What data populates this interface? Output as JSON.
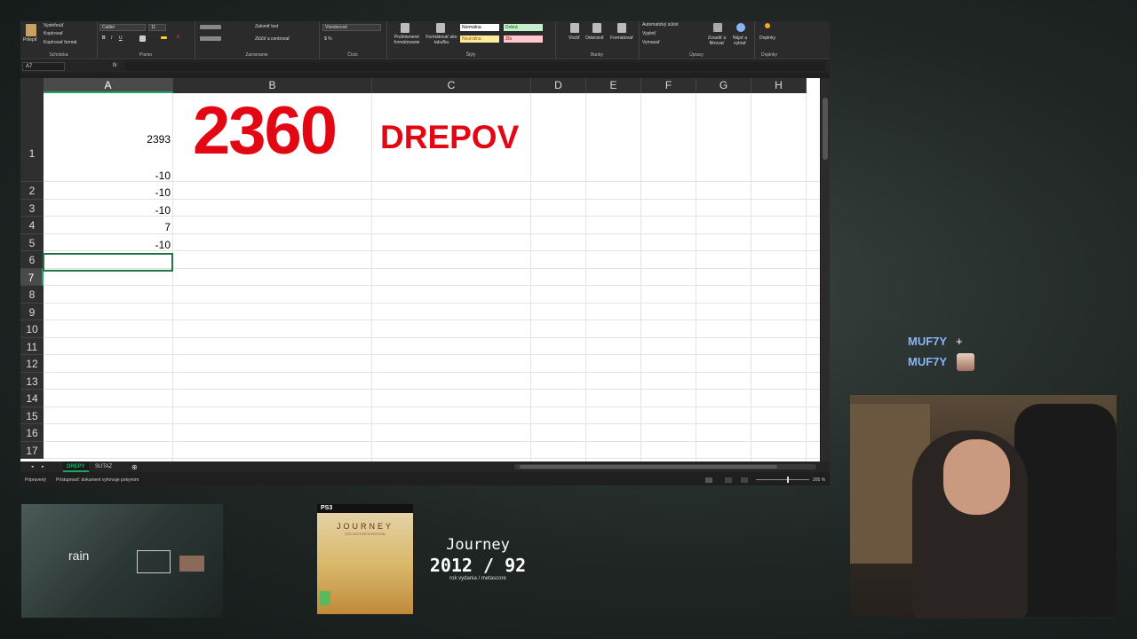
{
  "excel": {
    "ribbon": {
      "clipboard": {
        "paste": "Prilepiť",
        "cut": "Vystrihnúť",
        "copy": "Kopírovať",
        "format_painter": "Kopírovať formát",
        "label": "Schránka"
      },
      "font": {
        "name": "Calibri",
        "size": "11",
        "label": "Písmo"
      },
      "alignment": {
        "wrap": "Zalomiť text",
        "merge": "Zlúčiť a centrovať",
        "label": "Zarovnanie"
      },
      "number": {
        "format": "Všeobecné",
        "label": "Číslo"
      },
      "styles": {
        "conditional": "Podmienené formátovanie",
        "as_table": "Formátovať ako tabuľku",
        "normal": "Normálna",
        "good": "Dobrá",
        "neutral": "Neutrálna",
        "bad": "Zlá",
        "label": "Štýly"
      },
      "cells": {
        "insert": "Vložiť",
        "delete": "Odstrániť",
        "format": "Formátovať",
        "label": "Bunky"
      },
      "editing": {
        "autosum": "Automatický súčet",
        "fill": "Vyplniť",
        "clear": "Vymazať",
        "sort": "Zoradiť a filtrovať",
        "find": "Nájsť a vybrať",
        "label": "Úpravy"
      },
      "addins": {
        "addins": "Doplnky",
        "label": "Doplnky"
      }
    },
    "formula_bar": {
      "name_box": "A7",
      "fx": "fx"
    },
    "columns": [
      "A",
      "B",
      "C",
      "D",
      "E",
      "F",
      "G",
      "H"
    ],
    "rows": [
      "1",
      "2",
      "3",
      "4",
      "5",
      "6",
      "7",
      "8",
      "9",
      "10",
      "11",
      "12",
      "13",
      "14",
      "15",
      "16",
      "17"
    ],
    "cells": {
      "a1": "2393",
      "a2": "-10",
      "a3": "-10",
      "a4": "-10",
      "a5": "7",
      "a6": "-10"
    },
    "banner": {
      "count": "2360",
      "word": "DREPOV",
      "color": "#e30613"
    },
    "sheets": [
      "DREPY",
      "SUTAZ"
    ],
    "status": {
      "ready": "Pripravený",
      "accessibility": "Prístupnosť: dokument vyhovuje pokynom",
      "zoom": "205 %"
    }
  },
  "chat": {
    "users": [
      "MUF7Y",
      "MUF7Y"
    ]
  },
  "game": {
    "title": "Journey",
    "year_score": "2012 / 92",
    "caption": "rok vydania / metascore",
    "box_platform": "PS3",
    "box_title": "JOURNEY",
    "box_edition": "COLLECTOR'S EDITION"
  },
  "ps3_menu": {
    "label": "rain"
  }
}
